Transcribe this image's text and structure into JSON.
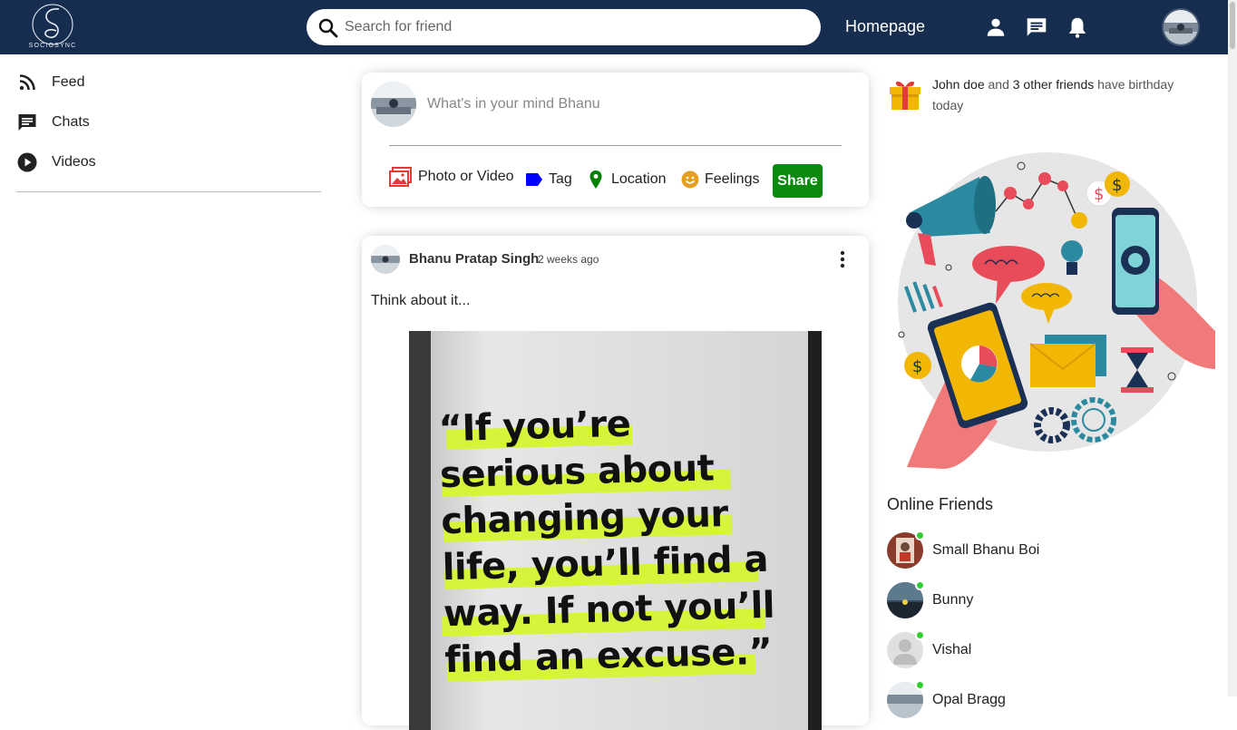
{
  "app": {
    "logo_text": "SOCIOSYNC"
  },
  "topbar": {
    "search_placeholder": "Search for friend",
    "homepage_label": "Homepage",
    "icons": [
      "person-icon",
      "chat-icon",
      "notifications-icon"
    ]
  },
  "sidebar": {
    "items": [
      {
        "label": "Feed",
        "icon": "rss-feed-icon"
      },
      {
        "label": "Chats",
        "icon": "chat-icon"
      },
      {
        "label": "Videos",
        "icon": "play-circle-icon"
      }
    ]
  },
  "share": {
    "placeholder": "What's in your mind Bhanu",
    "options": [
      {
        "label": "Photo or Video",
        "icon": "photo-icon",
        "color": "#e53935"
      },
      {
        "label": "Tag",
        "icon": "label-icon",
        "color": "#0000ff"
      },
      {
        "label": "Location",
        "icon": "location-pin-icon",
        "color": "#008000"
      },
      {
        "label": "Feelings",
        "icon": "emoji-icon",
        "color": "#e5a021"
      }
    ],
    "button_label": "Share",
    "button_color": "#0b8a10"
  },
  "post": {
    "username": "Bhanu Pratap Singh",
    "date": "2 weeks ago",
    "text": "Think about it...",
    "image_quote": "“If you’re\nserious about\nchanging your\nlife, you’ll find a\nway. If not you’ll\nfind an excuse.”"
  },
  "rightbar": {
    "birthday": {
      "name": "John doe",
      "and": "and",
      "others": "3 other friends",
      "rest": "have birthday today"
    },
    "online_title": "Online Friends",
    "friends": [
      {
        "name": "Small Bhanu Boi"
      },
      {
        "name": "Bunny"
      },
      {
        "name": "Vishal"
      },
      {
        "name": "Opal Bragg"
      }
    ]
  },
  "colors": {
    "topbar": "#172d50",
    "online_dot": "#32cd32"
  }
}
